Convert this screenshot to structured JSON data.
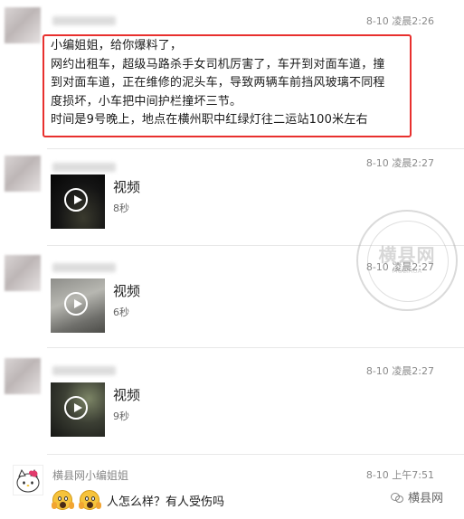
{
  "messages": {
    "text_message": {
      "timestamp": "8-10 凌晨2:26",
      "lines": [
        "小编姐姐，给你爆料了，",
        "网约出租车，超级马路杀手女司机厉害了，车开到对面车道，撞",
        "到对面车道，正在维修的泥头车，导致两辆车前挡风玻璃不同程",
        "度损坏，小车把中间护栏撞坏三节。",
        "时间是9号晚上，地点在横州职中红绿灯往二运站100米左右"
      ]
    },
    "videos": [
      {
        "timestamp": "8-10 凌晨2:27",
        "label": "视频",
        "duration": "8秒"
      },
      {
        "timestamp": "8-10 凌晨2:27",
        "label": "视频",
        "duration": "6秒"
      },
      {
        "timestamp": "8-10 凌晨2:27",
        "label": "视频",
        "duration": "9秒"
      }
    ],
    "reply": {
      "sender": "横县网小编姐姐",
      "timestamp": "8-10 上午7:51",
      "text": "人怎么样？有人受伤吗"
    }
  },
  "brand": {
    "name": "横县网"
  },
  "colors": {
    "highlight_border": "#e8302e",
    "timestamp": "#8a8a8a"
  }
}
